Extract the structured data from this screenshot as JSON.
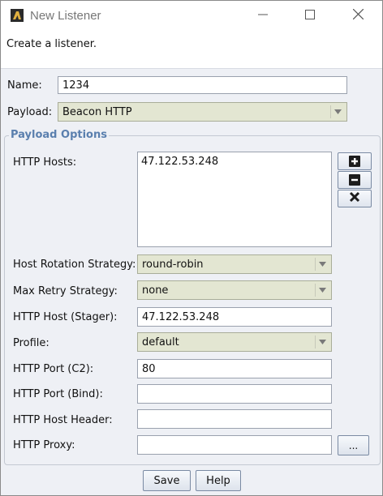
{
  "window": {
    "title": "New Listener"
  },
  "banner": {
    "text": "Create a listener."
  },
  "form": {
    "name_label": "Name:",
    "name_value": "1234",
    "payload_label": "Payload:",
    "payload_value": "Beacon HTTP"
  },
  "payload_options": {
    "title": "Payload Options",
    "http_hosts_label": "HTTP Hosts:",
    "http_hosts_value": "47.122.53.248",
    "host_rotation_label": "Host Rotation Strategy:",
    "host_rotation_value": "round-robin",
    "max_retry_label": "Max Retry Strategy:",
    "max_retry_value": "none",
    "stager_host_label": "HTTP Host (Stager):",
    "stager_host_value": "47.122.53.248",
    "profile_label": "Profile:",
    "profile_value": "default",
    "port_c2_label": "HTTP Port (C2):",
    "port_c2_value": "80",
    "port_bind_label": "HTTP Port (Bind):",
    "port_bind_value": "",
    "host_header_label": "HTTP Host Header:",
    "host_header_value": "",
    "proxy_label": "HTTP Proxy:",
    "proxy_value": "",
    "proxy_button": "..."
  },
  "buttons": {
    "save": "Save",
    "help": "Help"
  },
  "icons": {
    "app": "app-icon",
    "minimize": "minimize-icon",
    "maximize": "maximize-icon",
    "close": "close-icon",
    "add": "plus-icon",
    "remove": "minus-icon",
    "clear": "x-icon",
    "dropdown": "chevron-down-icon"
  },
  "colors": {
    "group_title": "#5a7fae",
    "combo_bg": "#e3e6d2",
    "window_bg": "#eef0f5"
  }
}
